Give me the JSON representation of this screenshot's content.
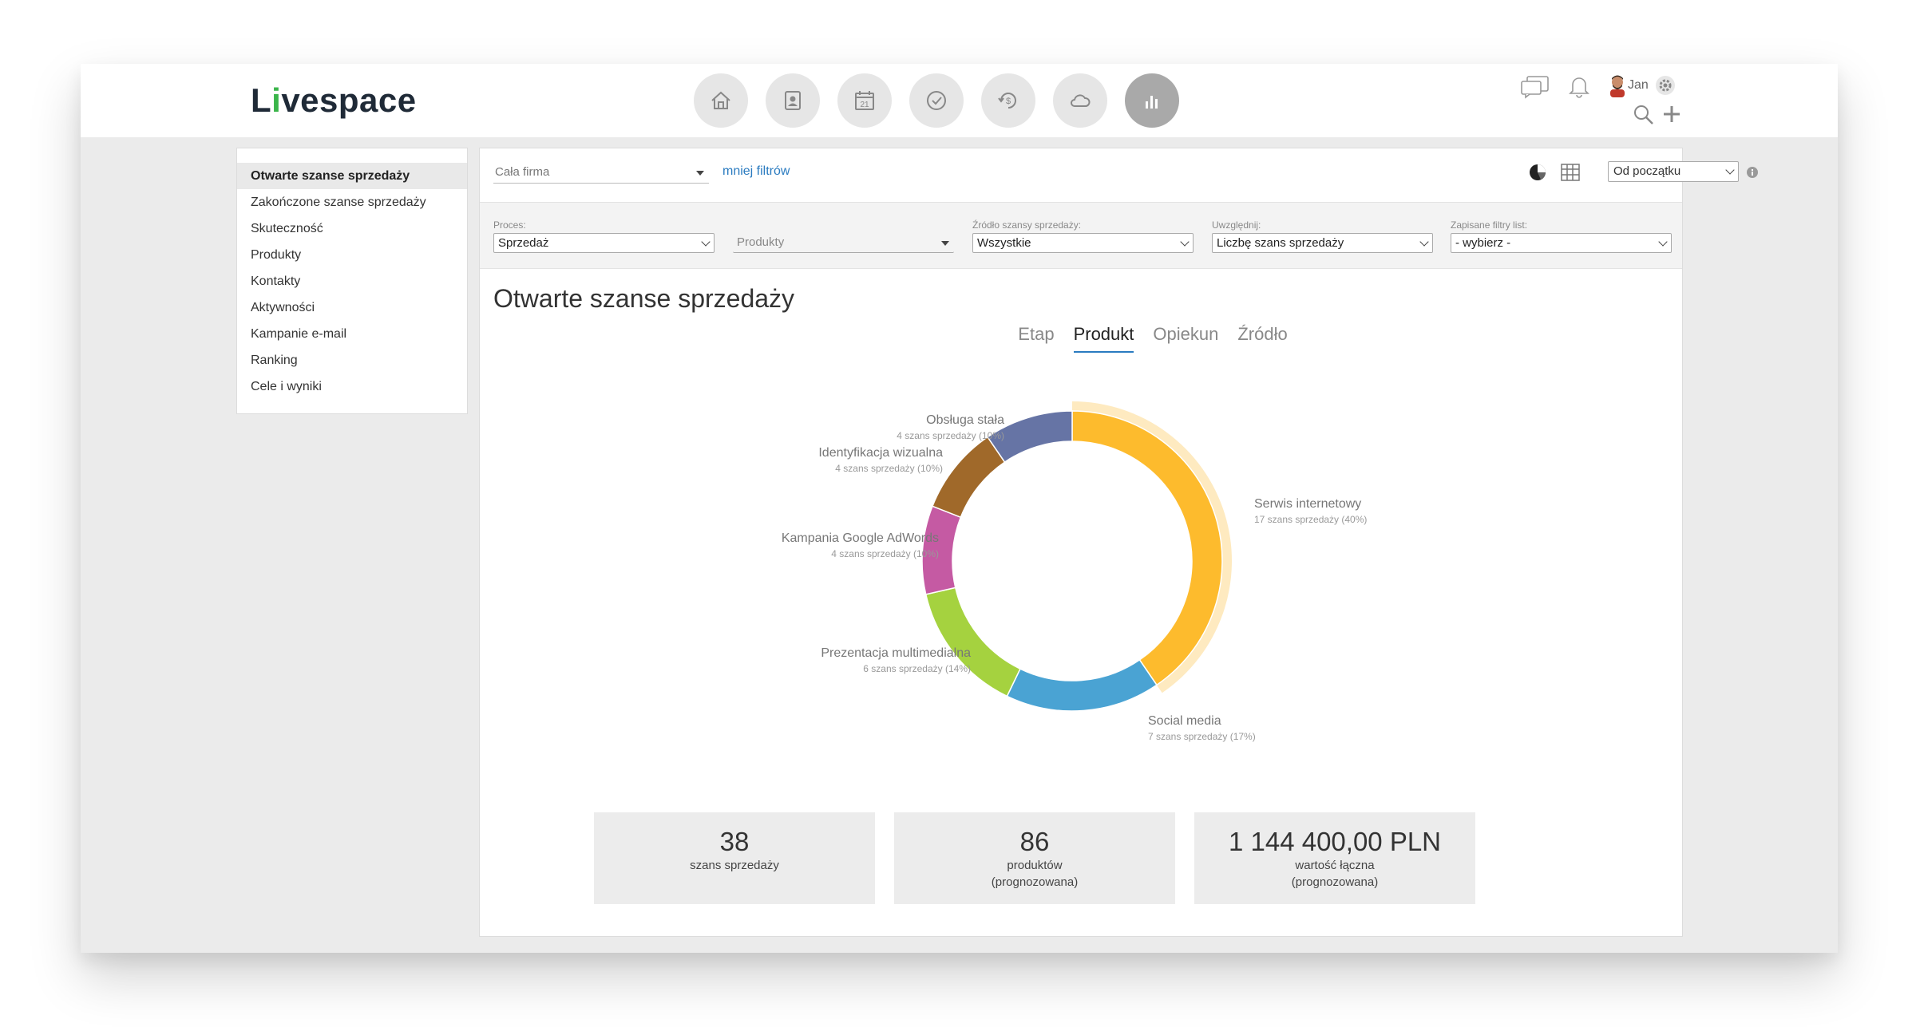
{
  "app": {
    "logo_text_pre": "L",
    "logo_text_v": "i",
    "logo_text_post": "vespace",
    "accent": "#2a7bc0",
    "logo_accent": "#3ab54a"
  },
  "header": {
    "modules": [
      {
        "icon": "home-icon",
        "active": false
      },
      {
        "icon": "contacts-icon",
        "active": false
      },
      {
        "icon": "calendar-icon",
        "calendar_day": "21",
        "active": false
      },
      {
        "icon": "check-icon",
        "active": false
      },
      {
        "icon": "deals-icon",
        "active": false
      },
      {
        "icon": "cloud-icon",
        "active": false
      },
      {
        "icon": "reports-icon",
        "active": true
      }
    ],
    "user": {
      "name": "Jan"
    }
  },
  "sidebar": {
    "items": [
      {
        "label": "Otwarte szanse sprzedaży",
        "active": true
      },
      {
        "label": "Zakończone szanse sprzedaży",
        "active": false
      },
      {
        "label": "Skuteczność",
        "active": false
      },
      {
        "label": "Produkty",
        "active": false
      },
      {
        "label": "Kontakty",
        "active": false
      },
      {
        "label": "Aktywności",
        "active": false
      },
      {
        "label": "Kampanie e-mail",
        "active": false
      },
      {
        "label": "Ranking",
        "active": false
      },
      {
        "label": "Cele i wyniki",
        "active": false
      }
    ]
  },
  "filters": {
    "scope": "Cała firma",
    "less_filters": "mniej filtrów",
    "period": "Od początku",
    "groups": [
      {
        "label": "Proces:",
        "value": "Sprzedaż",
        "ghost": false
      },
      {
        "label": "",
        "value": "Produkty",
        "ghost": true
      },
      {
        "label": "Źródło szansy sprzedaży:",
        "value": "Wszystkie",
        "ghost": false
      },
      {
        "label": "Uwzględnij:",
        "value": "Liczbę szans sprzedaży",
        "ghost": false
      },
      {
        "label": "Zapisane filtry list:",
        "value": "- wybierz -",
        "ghost": false
      }
    ]
  },
  "report": {
    "title": "Otwarte szanse sprzedaży",
    "tabs": [
      {
        "label": "Etap",
        "active": false
      },
      {
        "label": "Produkt",
        "active": true
      },
      {
        "label": "Opiekun",
        "active": false
      },
      {
        "label": "Źródło",
        "active": false
      }
    ]
  },
  "chart_data": {
    "type": "pie",
    "variant": "donut",
    "slices": [
      {
        "label": "Serwis internetowy",
        "detail": "17 szans sprzedaży (40%)",
        "value": 17,
        "percent": 40,
        "color": "#fdbb2d",
        "highlighted": true
      },
      {
        "label": "Social media",
        "detail": "7 szans sprzedaży (17%)",
        "value": 7,
        "percent": 17,
        "color": "#4aa3d3",
        "highlighted": false
      },
      {
        "label": "Prezentacja multimedialna",
        "detail": "6 szans sprzedaży (14%)",
        "value": 6,
        "percent": 14,
        "color": "#a5d23f",
        "highlighted": false
      },
      {
        "label": "Kampania Google AdWords",
        "detail": "4 szans sprzedaży (10%)",
        "value": 4,
        "percent": 10,
        "color": "#c55aa3",
        "highlighted": false
      },
      {
        "label": "Identyfikacja wizualna",
        "detail": "4 szans sprzedaży (10%)",
        "value": 4,
        "percent": 10,
        "color": "#a0692a",
        "highlighted": false
      },
      {
        "label": "Obsługa stała",
        "detail": "4 szans sprzedaży (10%)",
        "value": 4,
        "percent": 10,
        "color": "#6674a5",
        "highlighted": false
      }
    ]
  },
  "stats": [
    {
      "value": "38",
      "label": "szans sprzedaży",
      "sub": ""
    },
    {
      "value": "86",
      "label": "produktów",
      "sub": "(prognozowana)"
    },
    {
      "value": "1 144 400,00 PLN",
      "label": "wartość łączna",
      "sub": "(prognozowana)"
    }
  ]
}
